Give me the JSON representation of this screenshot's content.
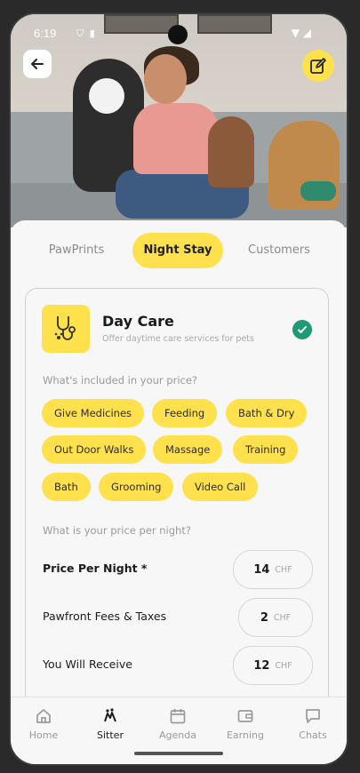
{
  "status": {
    "time": "6:19"
  },
  "header": {
    "back_icon": "arrow-left-icon",
    "edit_icon": "edit-icon"
  },
  "tabs": [
    {
      "label": "PawPrints",
      "active": false
    },
    {
      "label": "Night Stay",
      "active": true
    },
    {
      "label": "Customers",
      "active": false
    }
  ],
  "service": {
    "icon": "stethoscope-paw-icon",
    "title": "Day Care",
    "subtitle": "Offer daytime care services for pets",
    "selected": true
  },
  "included": {
    "question": "What's included in your price?",
    "chips": [
      "Give Medicines",
      "Feeding",
      "Bath & Dry",
      "Out Door Walks",
      "Massage",
      "Training",
      "Bath",
      "Grooming",
      "Video Call"
    ]
  },
  "pricing": {
    "question": "What is your price per night?",
    "rows": [
      {
        "label": "Price Per Night *",
        "value": "14",
        "currency": "CHF"
      },
      {
        "label": "Pawfront Fees & Taxes",
        "value": "2",
        "currency": "CHF"
      },
      {
        "label": "You Will Receive",
        "value": "12",
        "currency": "CHF"
      }
    ]
  },
  "nav": [
    {
      "label": "Home",
      "icon": "home-icon",
      "active": false
    },
    {
      "label": "Sitter",
      "icon": "sitter-icon",
      "active": true
    },
    {
      "label": "Agenda",
      "icon": "calendar-icon",
      "active": false
    },
    {
      "label": "Earning",
      "icon": "wallet-icon",
      "active": false
    },
    {
      "label": "Chats",
      "icon": "chat-icon",
      "active": false
    }
  ],
  "colors": {
    "accent": "#ffe14d",
    "check": "#1f9a78"
  }
}
